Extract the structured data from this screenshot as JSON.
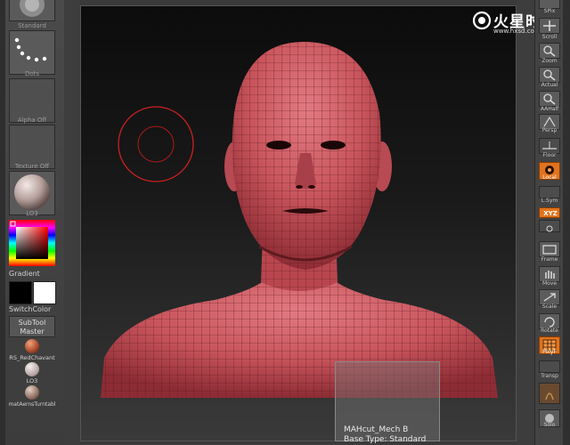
{
  "left_shelf": {
    "brush_label": "Standard",
    "stroke_label": "Dots",
    "alpha_label": "Alpha Off",
    "texture_label": "Texture Off",
    "material_label": "LO3",
    "gradient_label": "Gradient",
    "switchcolor_label": "SwitchColor",
    "subtool_line1": "SubTool",
    "subtool_line2": "Master",
    "materials": [
      {
        "label": "RS_RedChavant"
      },
      {
        "label": "LO3"
      },
      {
        "label": "matAernsTurntabl"
      }
    ]
  },
  "right_shelf": {
    "buttons": [
      {
        "label": "SPix"
      },
      {
        "label": "Scroll"
      },
      {
        "label": "Zoom"
      },
      {
        "label": "Actual"
      },
      {
        "label": "AAHalf"
      },
      {
        "label": "Persp"
      },
      {
        "label": "Floor"
      },
      {
        "label": "Local"
      },
      {
        "label": "L.Sym"
      },
      {
        "label": "XYZ"
      },
      {
        "label": "Frame"
      },
      {
        "label": "Move"
      },
      {
        "label": "Scale"
      },
      {
        "label": "Rotate"
      },
      {
        "label": "PolyF"
      },
      {
        "label": "Transp"
      },
      {
        "label": "Solo"
      }
    ]
  },
  "logo": {
    "title": "火星时代",
    "url": "www.hxsd.com"
  },
  "info": {
    "line1": "MAHcut_Mech B",
    "line2": "Base Type: Standard"
  },
  "colors": {
    "accent_orange": "#e0731f",
    "mesh_red": "#c8545c",
    "brush_cursor": "#cc2020"
  }
}
